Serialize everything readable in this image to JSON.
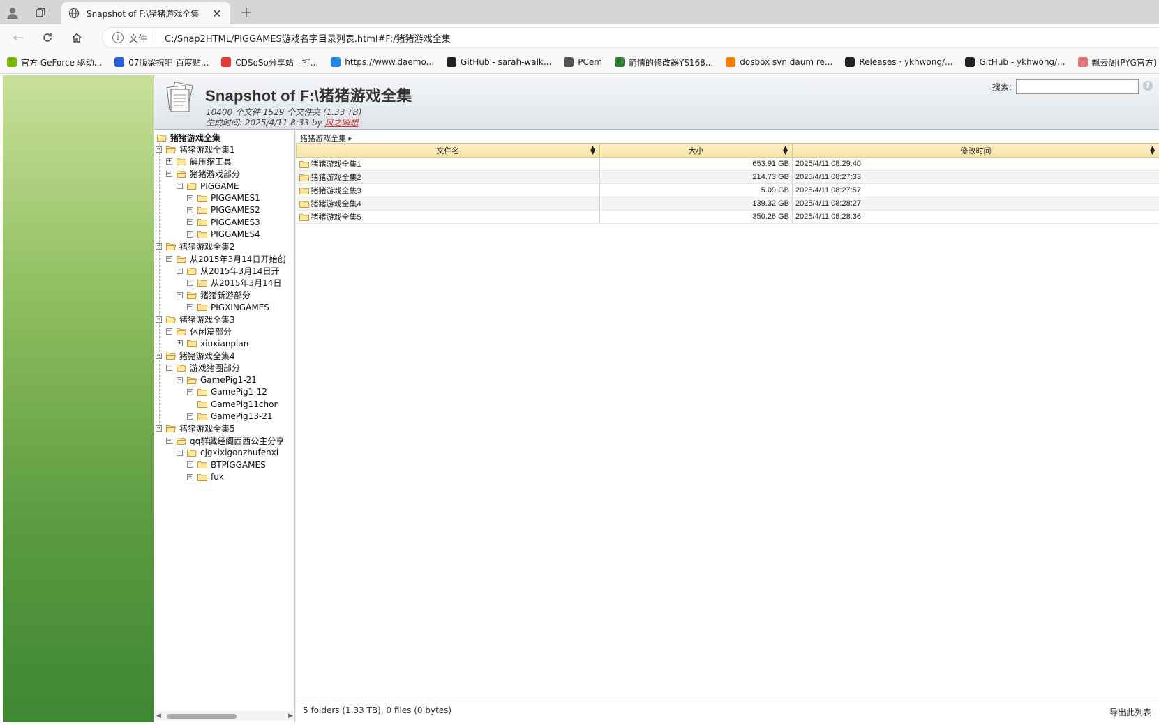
{
  "browser": {
    "tab_title": "Snapshot of F:\\猪猪游戏全集",
    "scheme_label": "文件",
    "url": "C:/Snap2HTML/PIGGAMES游戏名字目录列表.html#F:/猪猪游戏全集",
    "bookmarks": [
      {
        "label": "官方 GeForce 驱动...",
        "color": "#76b900"
      },
      {
        "label": "07版梁祝吧-百度贴...",
        "color": "#2b5fd9"
      },
      {
        "label": "CDSoSo分享站 - 打...",
        "color": "#e53935"
      },
      {
        "label": "https://www.daemo...",
        "color": "#1e88e5"
      },
      {
        "label": "GitHub - sarah-walk...",
        "color": "#222222"
      },
      {
        "label": "PCem",
        "color": "#555555"
      },
      {
        "label": "箭情的修改器YS168...",
        "color": "#2e7d32"
      },
      {
        "label": "dosbox svn daum re...",
        "color": "#f57c00"
      },
      {
        "label": "Releases · ykhwong/...",
        "color": "#222222"
      },
      {
        "label": "GitHub - ykhwong/...",
        "color": "#222222"
      },
      {
        "label": "飘云阁(PYG官方) 超...",
        "color": "#e57373"
      }
    ]
  },
  "header": {
    "title": "Snapshot of F:\\猪猪游戏全集",
    "stats": "10400 个文件 1529 个文件夹 (1.33 TB)",
    "generated_prefix": "生成时间:   2025/4/11 8:33 by ",
    "author": "风之瞬想",
    "search_label": "搜索:",
    "help": "?"
  },
  "tree": [
    {
      "label": "猪猪游戏全集",
      "level": 0,
      "toggle": "",
      "open": true
    },
    {
      "label": "猪猪游戏全集1",
      "level": 1,
      "toggle": "−",
      "open": true
    },
    {
      "label": "解压缩工具",
      "level": 2,
      "toggle": "+",
      "open": false
    },
    {
      "label": "猪猪游戏部分",
      "level": 2,
      "toggle": "−",
      "open": true
    },
    {
      "label": "PIGGAME",
      "level": 3,
      "toggle": "−",
      "open": true
    },
    {
      "label": "PIGGAMES1",
      "level": 4,
      "toggle": "+",
      "open": false
    },
    {
      "label": "PIGGAMES2",
      "level": 4,
      "toggle": "+",
      "open": false
    },
    {
      "label": "PIGGAMES3",
      "level": 4,
      "toggle": "+",
      "open": false
    },
    {
      "label": "PIGGAMES4",
      "level": 4,
      "toggle": "+",
      "open": false
    },
    {
      "label": "猪猪游戏全集2",
      "level": 1,
      "toggle": "−",
      "open": true
    },
    {
      "label": "从2015年3月14日开始创",
      "level": 2,
      "toggle": "−",
      "open": true
    },
    {
      "label": "从2015年3月14日开",
      "level": 3,
      "toggle": "−",
      "open": true
    },
    {
      "label": "从2015年3月14日",
      "level": 4,
      "toggle": "+",
      "open": false
    },
    {
      "label": "猪猪新游部分",
      "level": 3,
      "toggle": "−",
      "open": true
    },
    {
      "label": "PIGXINGAMES",
      "level": 4,
      "toggle": "+",
      "open": false
    },
    {
      "label": "猪猪游戏全集3",
      "level": 1,
      "toggle": "−",
      "open": true
    },
    {
      "label": "休闲篇部分",
      "level": 2,
      "toggle": "−",
      "open": true
    },
    {
      "label": "xiuxianpian",
      "level": 3,
      "toggle": "+",
      "open": false
    },
    {
      "label": "猪猪游戏全集4",
      "level": 1,
      "toggle": "−",
      "open": true
    },
    {
      "label": "游戏猪圈部分",
      "level": 2,
      "toggle": "−",
      "open": true
    },
    {
      "label": "GamePig1-21",
      "level": 3,
      "toggle": "−",
      "open": true
    },
    {
      "label": "GamePig1-12",
      "level": 4,
      "toggle": "+",
      "open": false
    },
    {
      "label": "GamePig11chon",
      "level": 4,
      "toggle": "",
      "open": false
    },
    {
      "label": "GamePig13-21",
      "level": 4,
      "toggle": "+",
      "open": false
    },
    {
      "label": "猪猪游戏全集5",
      "level": 1,
      "toggle": "−",
      "open": true
    },
    {
      "label": "qq群藏经阁西西公主分享",
      "level": 2,
      "toggle": "−",
      "open": true
    },
    {
      "label": "cjgxixigonzhufenxi",
      "level": 3,
      "toggle": "−",
      "open": true
    },
    {
      "label": "BTPIGGAMES",
      "level": 4,
      "toggle": "+",
      "open": false
    },
    {
      "label": "fuk",
      "level": 4,
      "toggle": "+",
      "open": false
    }
  ],
  "listing": {
    "breadcrumb": "猪猪游戏全集 ▸",
    "columns": {
      "name": "文件名",
      "size": "大小",
      "modified": "修改时间"
    },
    "rows": [
      {
        "name": "猪猪游戏全集1",
        "size": "653.91 GB",
        "modified": "2025/4/11 08:29:40"
      },
      {
        "name": "猪猪游戏全集2",
        "size": "214.73 GB",
        "modified": "2025/4/11 08:27:33"
      },
      {
        "name": "猪猪游戏全集3",
        "size": "5.09 GB",
        "modified": "2025/4/11 08:27:57"
      },
      {
        "name": "猪猪游戏全集4",
        "size": "139.32 GB",
        "modified": "2025/4/11 08:28:27"
      },
      {
        "name": "猪猪游戏全集5",
        "size": "350.26 GB",
        "modified": "2025/4/11 08:28:36"
      }
    ],
    "summary": "5 folders (1.33 TB), 0 files (0 bytes)",
    "export_label": "导出此列表"
  }
}
